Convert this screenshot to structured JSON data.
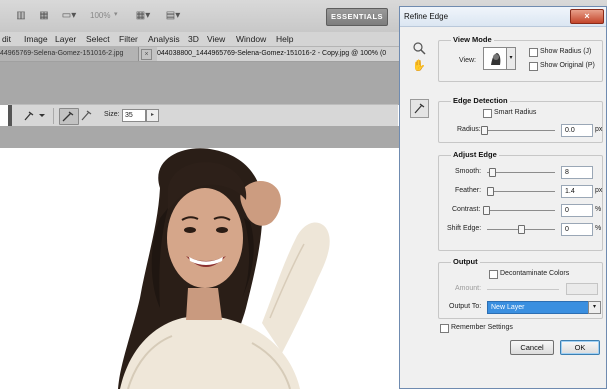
{
  "app_bar": {
    "zoom": "100%",
    "workspace_button": "ESSENTIALS"
  },
  "menu": [
    "dit",
    "Image",
    "Layer",
    "Select",
    "Filter",
    "Analysis",
    "3D",
    "View",
    "Window",
    "Help"
  ],
  "doc_tabs": {
    "tab1": "44965769-Selena-Gomez-151016-2.jpg",
    "tab2": "044038800_1444965769-Selena-Gomez-151016-2 - Copy.jpg @ 100% (0"
  },
  "options_bar": {
    "size_label": "Size:",
    "size_value": "35"
  },
  "dialog": {
    "title": "Refine Edge",
    "view_mode": {
      "title": "View Mode",
      "view_label": "View:",
      "show_radius": "Show Radius (J)",
      "show_original": "Show Original (P)"
    },
    "edge_detection": {
      "title": "Edge Detection",
      "smart_radius": "Smart Radius",
      "radius_label": "Radius:",
      "radius_value": "0.0",
      "radius_unit": "px"
    },
    "adjust_edge": {
      "title": "Adjust Edge",
      "smooth_label": "Smooth:",
      "smooth_value": "8",
      "feather_label": "Feather:",
      "feather_value": "1.4",
      "feather_unit": "px",
      "contrast_label": "Contrast:",
      "contrast_value": "0",
      "contrast_unit": "%",
      "shift_label": "Shift Edge:",
      "shift_value": "0",
      "shift_unit": "%"
    },
    "output": {
      "title": "Output",
      "decontaminate": "Decontaminate Colors",
      "amount_label": "Amount:",
      "output_to_label": "Output To:",
      "output_to_value": "New Layer"
    },
    "remember_settings": "Remember Settings",
    "cancel": "Cancel",
    "ok": "OK"
  },
  "colors": {
    "dialog_accent": "#3a8fe0",
    "ok_border": "#3c7fb1"
  }
}
